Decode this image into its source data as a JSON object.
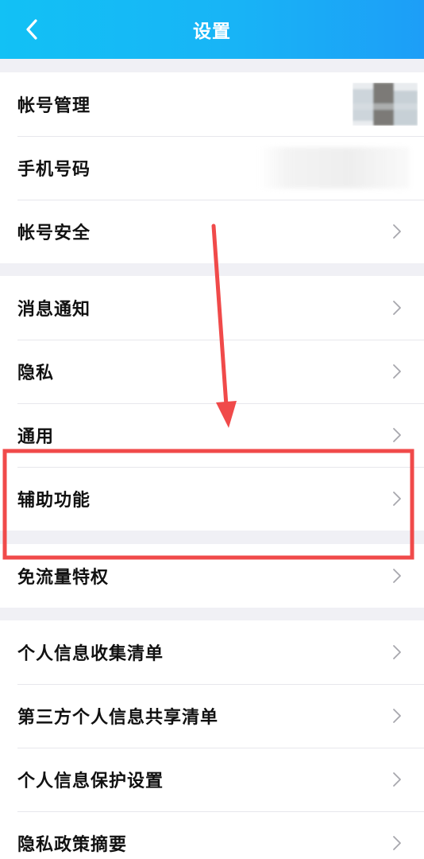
{
  "header": {
    "title": "设置",
    "back_icon": "chevron-left-icon"
  },
  "colors": {
    "header_gradient_start": "#12c1f5",
    "header_gradient_end": "#1d9ef7",
    "annotation_red": "#f04a4a"
  },
  "sections": [
    {
      "items": [
        {
          "label": "帐号管理"
        },
        {
          "label": "手机号码"
        },
        {
          "label": "帐号安全"
        }
      ]
    },
    {
      "items": [
        {
          "label": "消息通知"
        },
        {
          "label": "隐私"
        },
        {
          "label": "通用"
        },
        {
          "label": "辅助功能"
        }
      ]
    },
    {
      "items": [
        {
          "label": "免流量特权"
        }
      ]
    },
    {
      "items": [
        {
          "label": "个人信息收集清单"
        },
        {
          "label": "第三方个人信息共享清单"
        },
        {
          "label": "个人信息保护设置"
        },
        {
          "label": "隐私政策摘要"
        }
      ]
    }
  ]
}
